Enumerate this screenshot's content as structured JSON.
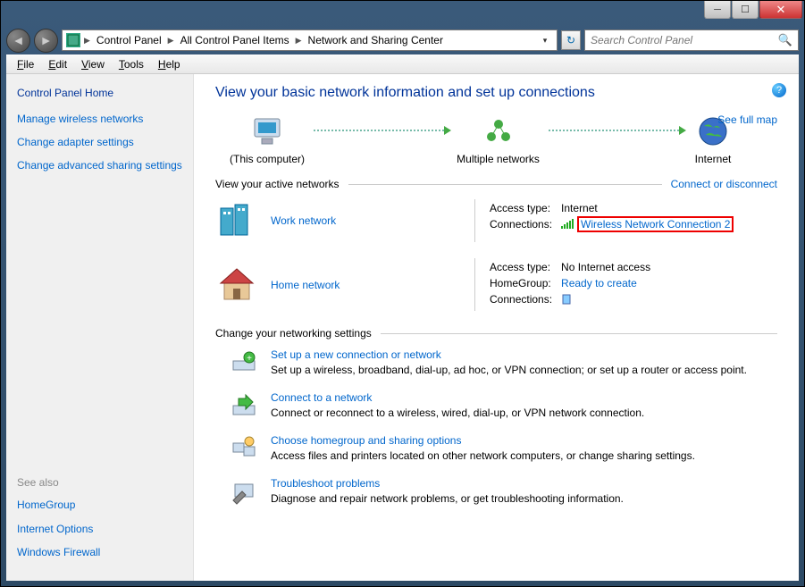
{
  "breadcrumb": {
    "root": "Control Panel",
    "mid": "All Control Panel Items",
    "leaf": "Network and Sharing Center"
  },
  "search": {
    "placeholder": "Search Control Panel"
  },
  "menu": {
    "file": "File",
    "edit": "Edit",
    "view": "View",
    "tools": "Tools",
    "help": "Help"
  },
  "sidebar": {
    "home": "Control Panel Home",
    "links": [
      "Manage wireless networks",
      "Change adapter settings",
      "Change advanced sharing settings"
    ],
    "seealso_hdr": "See also",
    "seealso": [
      "HomeGroup",
      "Internet Options",
      "Windows Firewall"
    ]
  },
  "main": {
    "title": "View your basic network information and set up connections",
    "map": {
      "node1": "(This computer)",
      "node2": "Multiple networks",
      "node3": "Internet",
      "fullmap": "See full map"
    },
    "active_hdr": "View your active networks",
    "connect_link": "Connect or disconnect",
    "net1": {
      "name": "Work network",
      "access_lbl": "Access type:",
      "access_val": "Internet",
      "conn_lbl": "Connections:",
      "conn_val": "Wireless Network Connection 2"
    },
    "net2": {
      "name": "Home network",
      "access_lbl": "Access type:",
      "access_val": "No Internet access",
      "hg_lbl": "HomeGroup:",
      "hg_val": "Ready to create",
      "conn_lbl": "Connections:"
    },
    "change_hdr": "Change your networking settings",
    "tasks": [
      {
        "t": "Set up a new connection or network",
        "d": "Set up a wireless, broadband, dial-up, ad hoc, or VPN connection; or set up a router or access point."
      },
      {
        "t": "Connect to a network",
        "d": "Connect or reconnect to a wireless, wired, dial-up, or VPN network connection."
      },
      {
        "t": "Choose homegroup and sharing options",
        "d": "Access files and printers located on other network computers, or change sharing settings."
      },
      {
        "t": "Troubleshoot problems",
        "d": "Diagnose and repair network problems, or get troubleshooting information."
      }
    ]
  }
}
